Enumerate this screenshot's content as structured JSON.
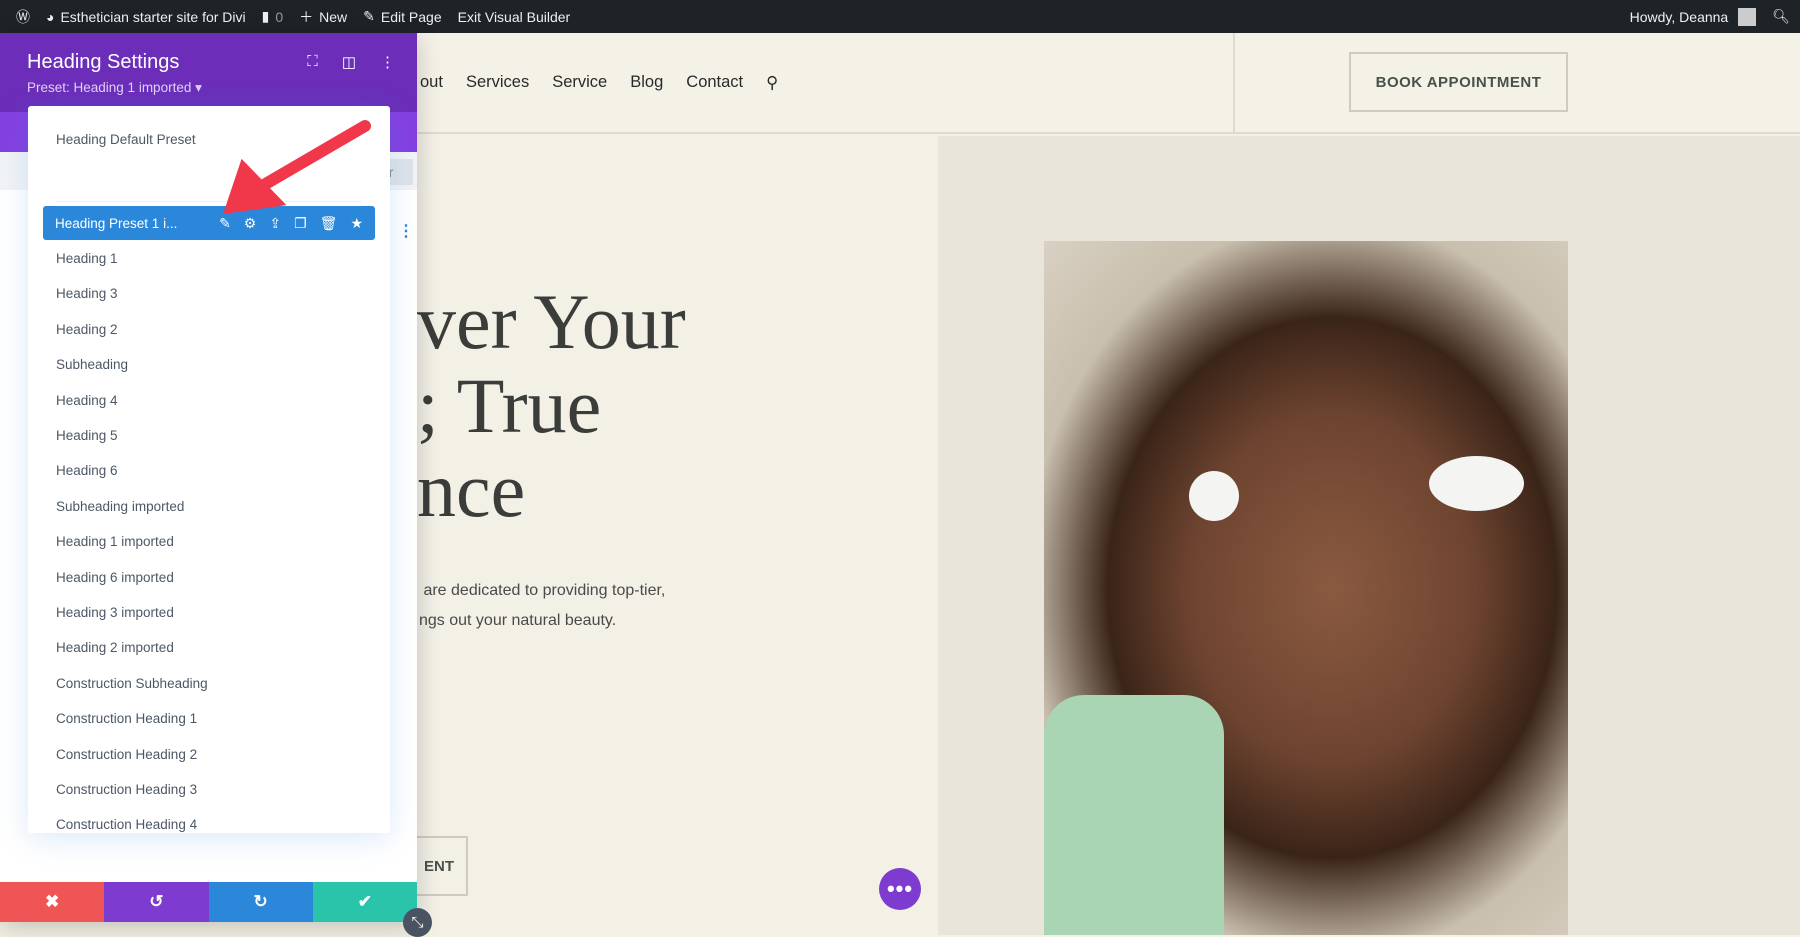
{
  "adminbar": {
    "site": "Esthetician starter site for Divi",
    "comments": "0",
    "new": "New",
    "edit": "Edit Page",
    "exit": "Exit Visual Builder",
    "howdy": "Howdy, Deanna"
  },
  "header": {
    "nav": [
      "out",
      "Services",
      "Service",
      "Blog",
      "Contact"
    ],
    "book": "BOOK APPOINTMENT"
  },
  "hero": {
    "heading": "ver Your\n; True\nnce",
    "paragraph": " are dedicated to providing top-tier,\nngs out your natural beauty.",
    "cta": "ENT"
  },
  "panel": {
    "title": "Heading Settings",
    "preset": "Preset: Heading 1 imported ▾",
    "partial_tab": "er",
    "default_preset": "Heading Default Preset",
    "selected": "Heading Preset 1 i...",
    "items": [
      "Heading 1",
      "Heading 3",
      "Heading 2",
      "Subheading",
      "Heading 4",
      "Heading 5",
      "Heading 6",
      "Subheading imported",
      "Heading 1 imported",
      "Heading 6 imported",
      "Heading 3 imported",
      "Heading 2 imported",
      "Construction Subheading",
      "Construction Heading 1",
      "Construction Heading 2",
      "Construction Heading 3",
      "Construction Heading 4"
    ]
  },
  "colors": {
    "panel_header": "#6c2eb9",
    "selected": "#2b87da",
    "cancel": "#ef5555",
    "undo": "#7e3bd0",
    "redo": "#2b87da",
    "save": "#29c4a9",
    "annotation_arrow": "#f0384a"
  }
}
